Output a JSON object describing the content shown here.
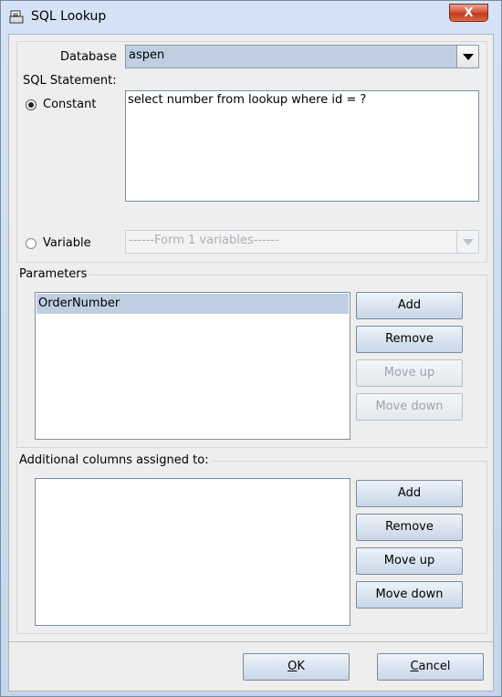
{
  "window": {
    "title": "SQL Lookup",
    "close_label": "X"
  },
  "database": {
    "label": "Database",
    "value": "aspen"
  },
  "sql_statement": {
    "label": "SQL Statement:"
  },
  "constant": {
    "label": "Constant",
    "value": "select number from lookup where id = ?",
    "selected": true
  },
  "variable": {
    "label": "Variable",
    "placeholder": "------Form 1 variables------",
    "selected": false
  },
  "parameters": {
    "legend": "Parameters",
    "items": [
      "OrderNumber"
    ],
    "buttons": {
      "add": "Add",
      "remove": "Remove",
      "move_up": "Move up",
      "move_down": "Move down"
    }
  },
  "additional": {
    "legend": "Additional columns assigned to:",
    "items": [],
    "buttons": {
      "add": "Add",
      "remove": "Remove",
      "move_up": "Move up",
      "move_down": "Move down"
    }
  },
  "footer": {
    "ok_mnemonic": "O",
    "ok_rest": "K",
    "cancel_mnemonic": "C",
    "cancel_rest": "ancel"
  },
  "colors": {
    "selection": "#bfcfe1",
    "close_button": "#c1391c",
    "dialog_bg": "#eeeeee"
  }
}
